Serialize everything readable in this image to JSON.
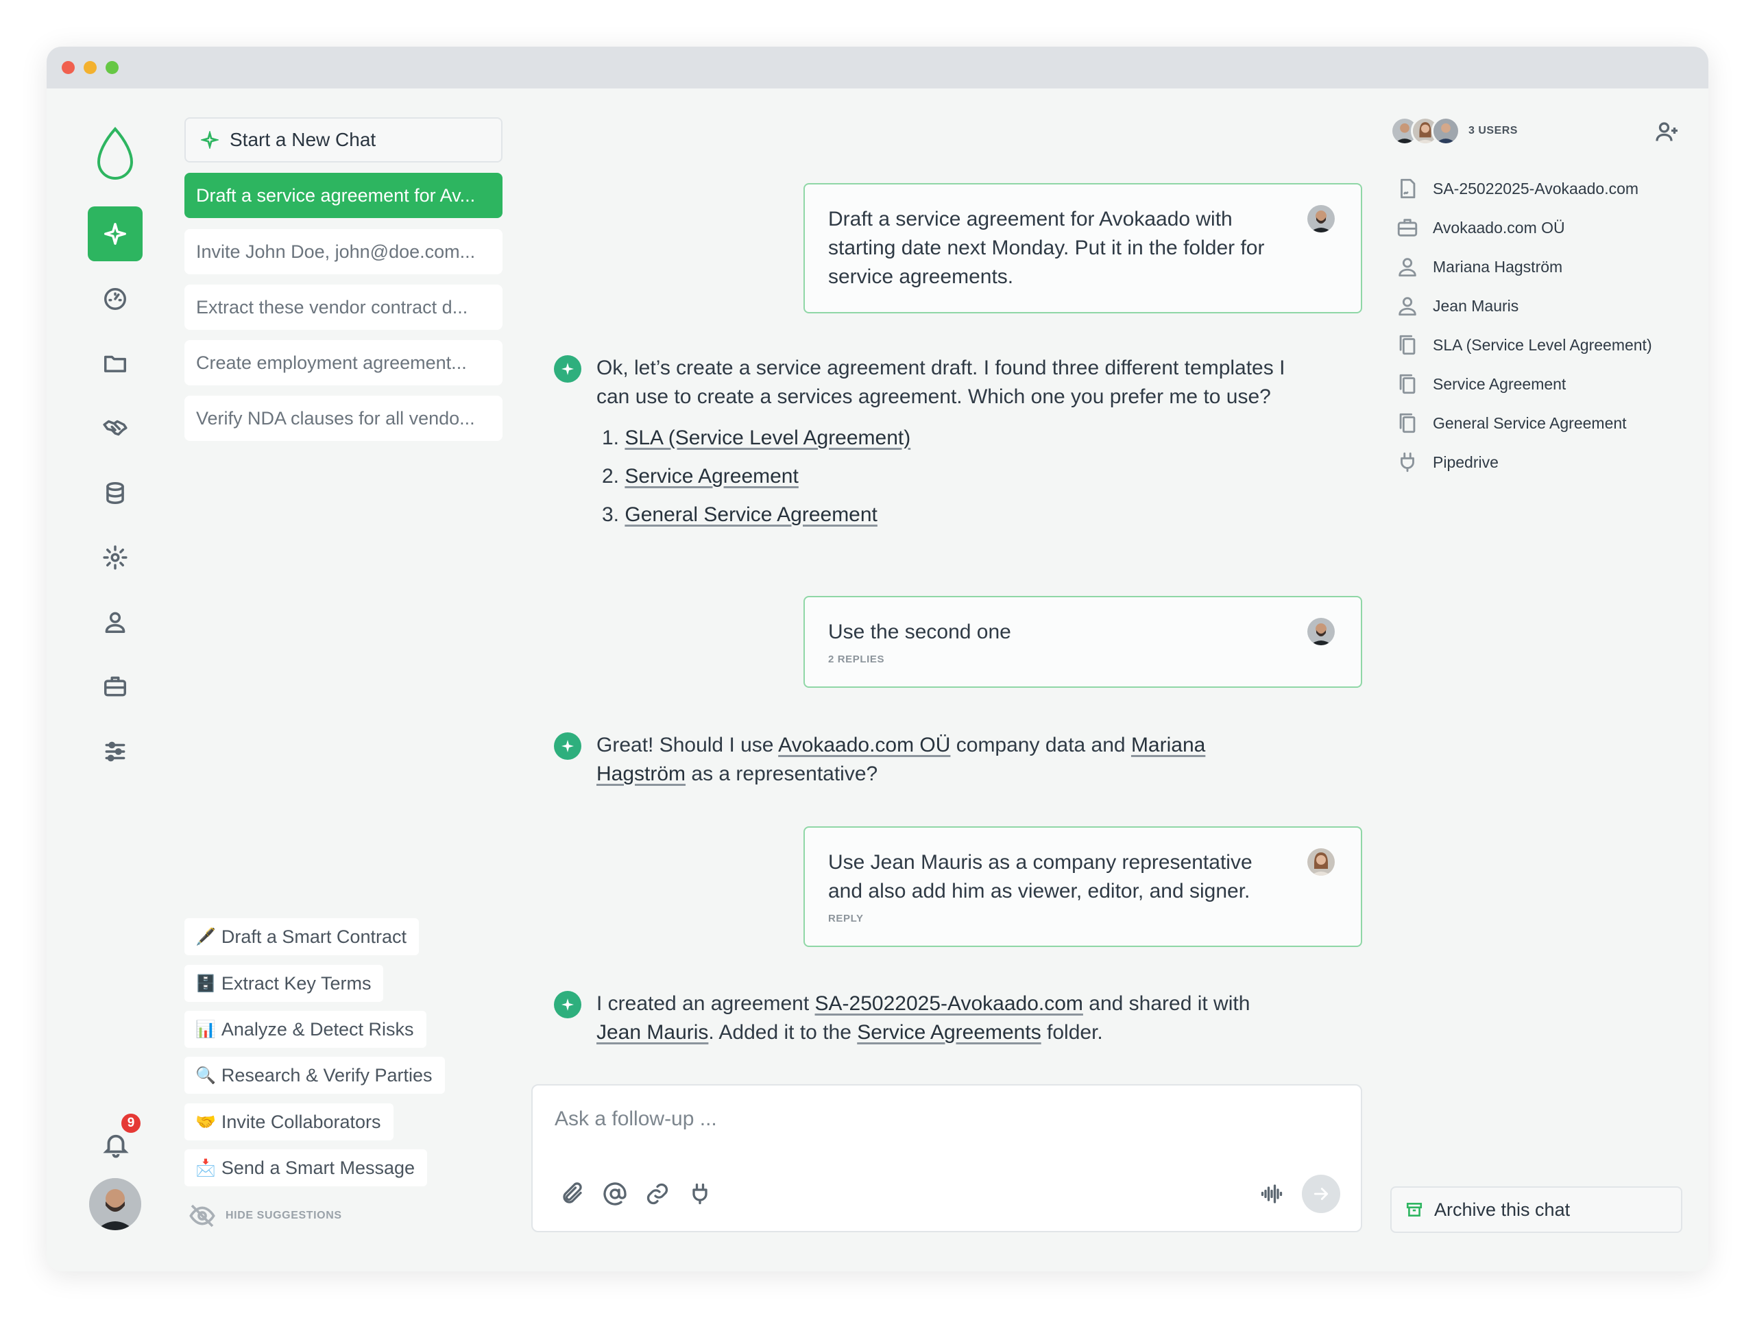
{
  "sidebar_rail": {
    "items": [
      "assistant-icon",
      "dashboard-icon",
      "folder-icon",
      "handshake-icon",
      "database-icon",
      "settings-icon",
      "user-icon",
      "briefcase-icon",
      "sliders-icon"
    ],
    "notifications_count": "9"
  },
  "chats": {
    "new_chat_label": "Start a New Chat",
    "items": [
      "Draft a service agreement for Av...",
      "Invite John Doe, john@doe.com...",
      "Extract these vendor contract d...",
      "Create employment agreement...",
      "Verify NDA clauses for all vendo..."
    ]
  },
  "suggestions": {
    "items": [
      {
        "emoji": "🖋️",
        "label": "Draft a Smart Contract"
      },
      {
        "emoji": "🗄️",
        "label": "Extract Key Terms"
      },
      {
        "emoji": "📊",
        "label": "Analyze & Detect Risks"
      },
      {
        "emoji": "🔍",
        "label": "Research & Verify Parties"
      },
      {
        "emoji": "🤝",
        "label": "Invite Collaborators"
      },
      {
        "emoji": "📩",
        "label": "Send a Smart Message"
      }
    ],
    "hide_label": "HIDE SUGGESTIONS"
  },
  "messages": {
    "m1": {
      "text": "Draft a service agreement for Avokaado with starting date next Monday. Put it in the folder for service agreements."
    },
    "m2": {
      "text": "Ok, let’s create a service agreement draft. I found three different templates I can use to create a services agreement. Which one you prefer me to use?",
      "options": [
        "SLA (Service Level Agreement)",
        "Service Agreement",
        "General Service Agreement"
      ]
    },
    "m3": {
      "text": "Use the second one",
      "meta": "2 REPLIES"
    },
    "m4": {
      "p1": "Great! Should I use ",
      "l1": "Avokaado.com OÜ",
      "p2": " company data and ",
      "l2": "Mariana Hagström",
      "p3": " as a representative?"
    },
    "m5": {
      "text": "Use Jean Mauris as a company representative and also add him as viewer, editor, and signer.",
      "meta": "REPLY"
    },
    "m6": {
      "p1": "I created an agreement ",
      "l1": "SA-25022025-Avokaado.com",
      "p2": " and shared it with ",
      "l2": "Jean Mauris",
      "p3": ". Added it to the ",
      "l3": "Service Agreements",
      "p4": " folder."
    }
  },
  "composer": {
    "placeholder": "Ask a follow-up ..."
  },
  "right_panel": {
    "users_label": "3 USERS",
    "refs": [
      {
        "icon": "document-icon",
        "label": "SA-25022025-Avokaado.com"
      },
      {
        "icon": "briefcase-icon",
        "label": "Avokaado.com OÜ"
      },
      {
        "icon": "person-icon",
        "label": "Mariana Hagström"
      },
      {
        "icon": "person-icon",
        "label": "Jean Mauris"
      },
      {
        "icon": "copy-icon",
        "label": "SLA (Service Level Agreement)"
      },
      {
        "icon": "copy-icon",
        "label": "Service Agreement"
      },
      {
        "icon": "copy-icon",
        "label": "General Service Agreement"
      },
      {
        "icon": "plug-icon",
        "label": "Pipedrive"
      }
    ],
    "archive_label": "Archive this chat"
  },
  "colors": {
    "accent": "#2db560",
    "bot_icon": "#2eaf7d",
    "badge": "#e53935",
    "user_border": "#8fd7a6"
  }
}
